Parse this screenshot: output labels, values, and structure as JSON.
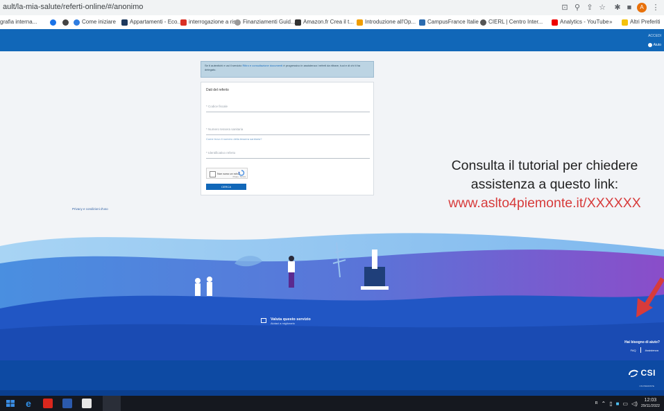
{
  "browser": {
    "url": "ault/la-mia-salute/referti-online/#/anonimo",
    "bookmarks": [
      {
        "label": "grafia interna..."
      },
      {
        "label": ""
      },
      {
        "label": ""
      },
      {
        "label": "Come iniziare"
      },
      {
        "label": "Appartamenti - Eco..."
      },
      {
        "label": "interrogazione a ris..."
      },
      {
        "label": "Finanziamenti Guid..."
      },
      {
        "label": "Amazon.fr Crea il t..."
      },
      {
        "label": "Introduzione all'Op..."
      },
      {
        "label": "CampusFrance Italie"
      },
      {
        "label": "CIERL | Centro Inter..."
      },
      {
        "label": "Analytics - YouTube"
      }
    ],
    "more_bookmarks": "»",
    "other_favorites": "Altri Preferiti",
    "avatar_letter": "A"
  },
  "header": {
    "top_right": "ACCEDI",
    "user_label": "Aiuto"
  },
  "info_box": {
    "text_start": "Se ti autentichi e usi il servizio",
    "link": "Ritiro e consultazione documenti",
    "text_end": "è progressivo in assistenza i referti da ritirare, tuoi e di chi ti ha delegato."
  },
  "form": {
    "title": "Dati del referto",
    "field1_placeholder": "* Codice fiscale",
    "field2_placeholder": "* Numero tessera sanitaria",
    "field2_help": "Come trovo il numero della tessera sanitaria?",
    "field3_placeholder": "* Identificativo referto",
    "captcha_label": "Non sono un robot",
    "captcha_brand": "reCAPTCHA",
    "captcha_terms": "Privacy - Termini",
    "submit": "CERCA"
  },
  "privacy_link": "Privacy e condizioni d'uso",
  "tutorial": {
    "line1": "Consulta il tutorial per chiedere",
    "line2": "assistenza a questo link:",
    "line3": "www.aslto4piemonte.it/XXXXXX"
  },
  "survey": {
    "title": "Valuta questo servizio",
    "subtitle": "Aiutaci a migliorarlo"
  },
  "help": {
    "title": "Hai bisogno di aiuto?",
    "faq": "FAQ",
    "assistance": "Assistenza"
  },
  "footer": {
    "logo": "CSI",
    "logo_sub": "CSI PIEMONTE"
  },
  "taskbar": {
    "time": "12:03",
    "date": "29/11/2022"
  },
  "colors": {
    "header_blue": "#1167b8",
    "arrow_red": "#d73b3b",
    "link_red": "#d73b3b"
  }
}
